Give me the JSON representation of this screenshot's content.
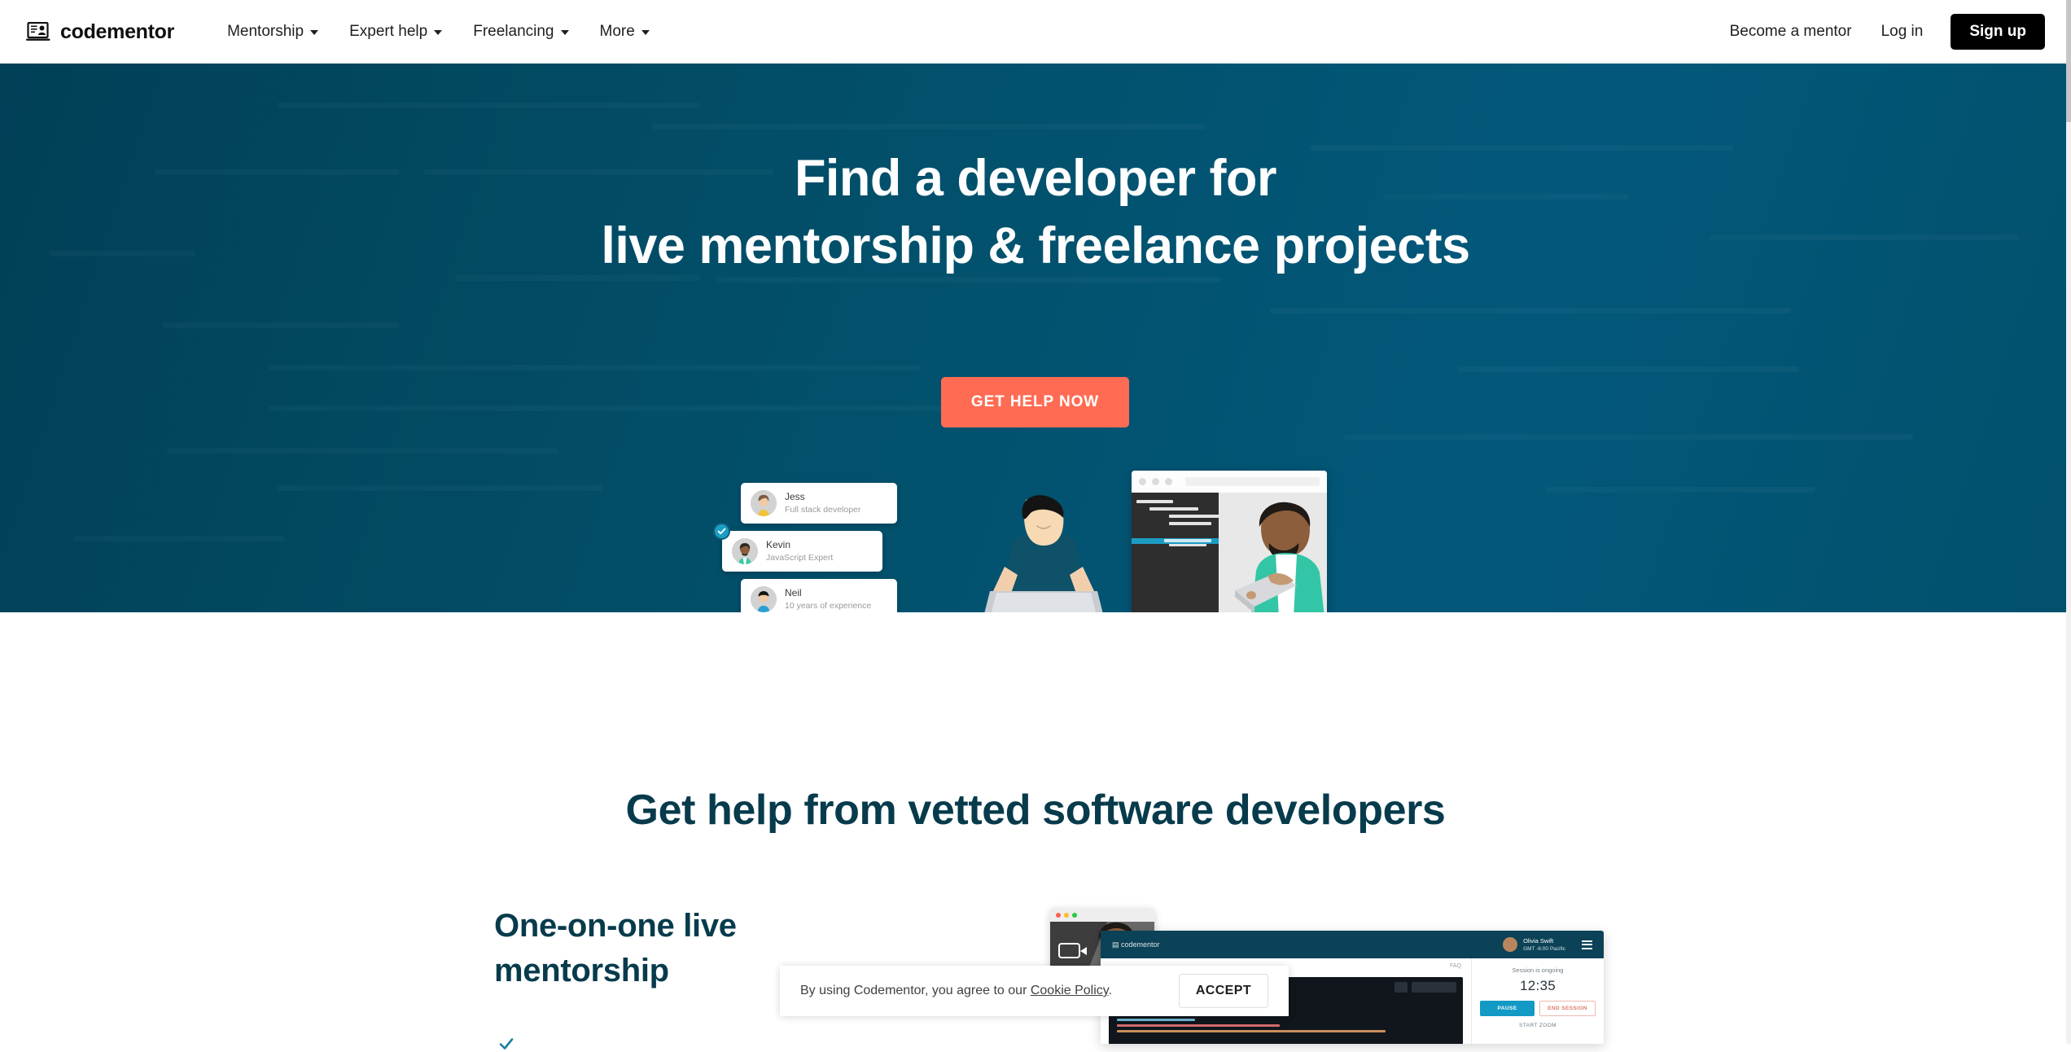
{
  "header": {
    "brand": {
      "name": "codementor",
      "icon": "codementor-logo-icon"
    },
    "nav": [
      {
        "label": "Mentorship",
        "icon": "chevron-down-icon"
      },
      {
        "label": "Expert help",
        "icon": "chevron-down-icon"
      },
      {
        "label": "Freelancing",
        "icon": "chevron-down-icon"
      },
      {
        "label": "More",
        "icon": "chevron-down-icon"
      }
    ],
    "become_mentor": "Become a mentor",
    "login": "Log in",
    "signup": "Sign up"
  },
  "hero": {
    "title_line1": "Find a developer for",
    "title_line2": "live mentorship & freelance projects",
    "cta": "GET HELP NOW",
    "bg_color": "#02506b",
    "cta_color": "#ff6c53",
    "mentors": [
      {
        "name": "Jess",
        "role": "Full stack developer",
        "verified": false
      },
      {
        "name": "Kevin",
        "role": "JavaScript Expert",
        "verified": true
      },
      {
        "name": "Neil",
        "role": "10 years of experience",
        "verified": false
      }
    ]
  },
  "section2": {
    "title": "Get help from vetted software developers",
    "subtitle": "One-on-one live mentorship",
    "accent_color": "#073b4c",
    "product": {
      "user_name": "Olivia Swift",
      "user_timezone": "GMT -6:00 Pacific",
      "faq_label": "FAQ",
      "session_status": "Session is ongoing",
      "session_timer": "12:35",
      "pause_label": "PAUSE",
      "end_label": "END SESSION",
      "zoom_label": "START ZOOM"
    }
  },
  "cookie": {
    "text_before": "By using Codementor, you agree to our ",
    "link": "Cookie Policy",
    "text_after": ".",
    "accept": "ACCEPT"
  }
}
